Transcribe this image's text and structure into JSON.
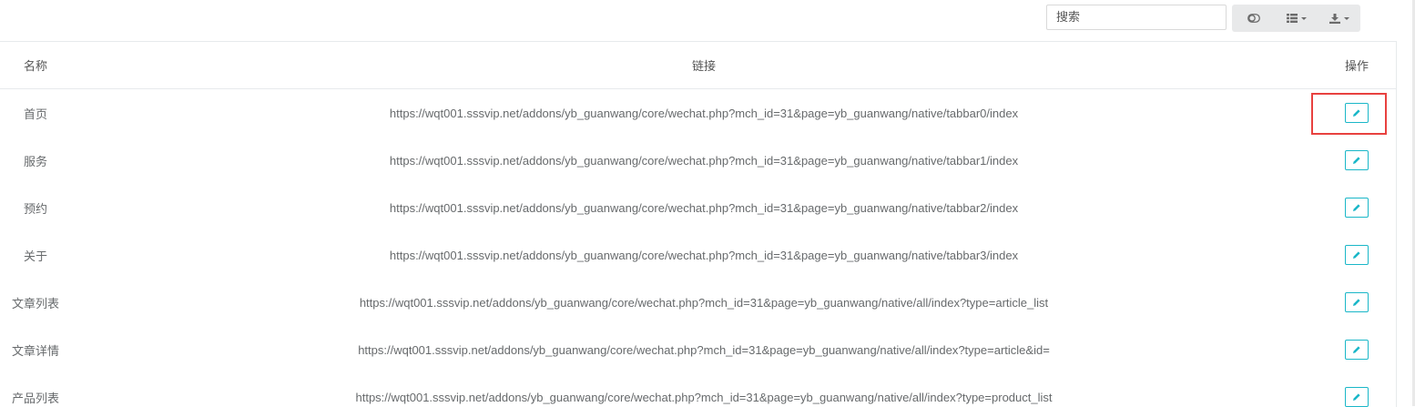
{
  "toolbar": {
    "search_placeholder": "搜索",
    "buttons": [
      {
        "icon": "toggle-icon"
      },
      {
        "icon": "columns-list-icon"
      },
      {
        "icon": "export-download-icon"
      }
    ]
  },
  "table": {
    "headers": {
      "name": "名称",
      "link": "链接",
      "op": "操作"
    },
    "rows": [
      {
        "name": "首页",
        "link": "https://wqt001.sssvip.net/addons/yb_guanwang/core/wechat.php?mch_id=31&page=yb_guanwang/native/tabbar0/index"
      },
      {
        "name": "服务",
        "link": "https://wqt001.sssvip.net/addons/yb_guanwang/core/wechat.php?mch_id=31&page=yb_guanwang/native/tabbar1/index"
      },
      {
        "name": "预约",
        "link": "https://wqt001.sssvip.net/addons/yb_guanwang/core/wechat.php?mch_id=31&page=yb_guanwang/native/tabbar2/index"
      },
      {
        "name": "关于",
        "link": "https://wqt001.sssvip.net/addons/yb_guanwang/core/wechat.php?mch_id=31&page=yb_guanwang/native/tabbar3/index"
      },
      {
        "name": "文章列表",
        "link": "https://wqt001.sssvip.net/addons/yb_guanwang/core/wechat.php?mch_id=31&page=yb_guanwang/native/all/index?type=article_list"
      },
      {
        "name": "文章详情",
        "link": "https://wqt001.sssvip.net/addons/yb_guanwang/core/wechat.php?mch_id=31&page=yb_guanwang/native/all/index?type=article&id="
      },
      {
        "name": "产品列表",
        "link": "https://wqt001.sssvip.net/addons/yb_guanwang/core/wechat.php?mch_id=31&page=yb_guanwang/native/all/index?type=product_list"
      }
    ]
  },
  "colors": {
    "accent": "#1ab7c8",
    "highlight": "#e8413f"
  }
}
